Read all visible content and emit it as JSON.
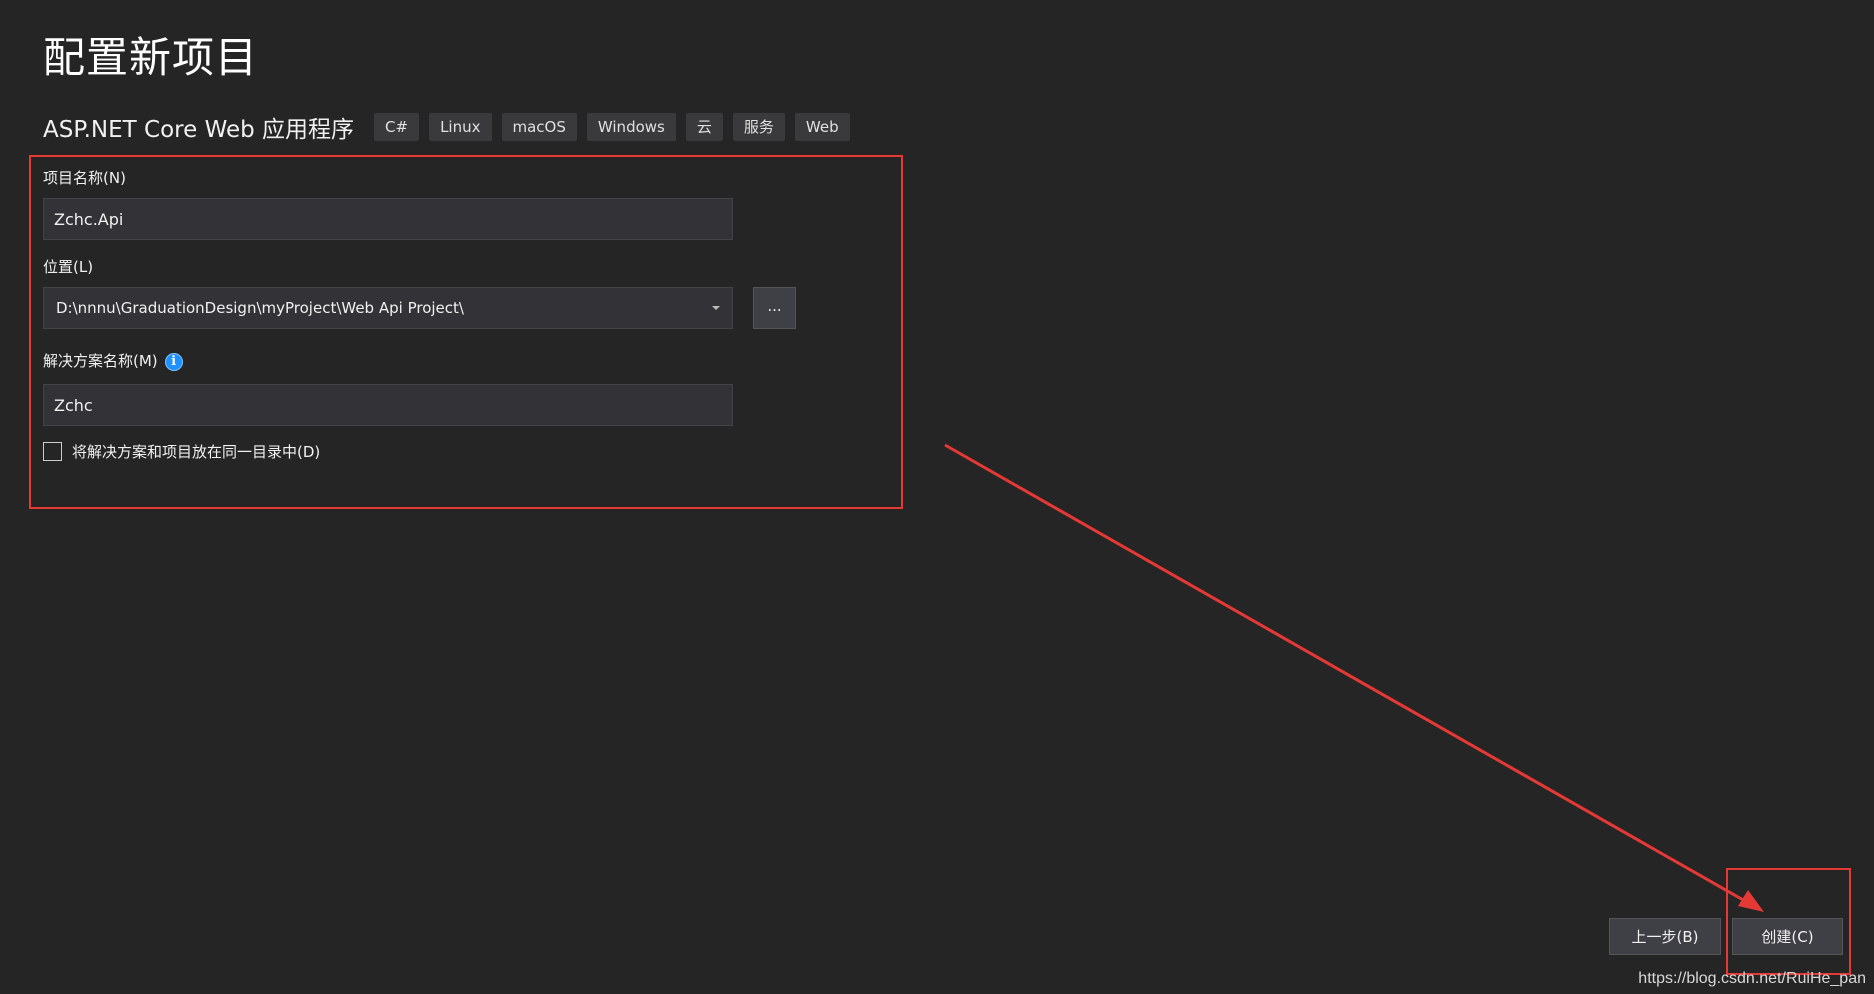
{
  "page": {
    "title": "配置新项目"
  },
  "template": {
    "name": "ASP.NET Core Web 应用程序",
    "tags": [
      "C#",
      "Linux",
      "macOS",
      "Windows",
      "云",
      "服务",
      "Web"
    ]
  },
  "form": {
    "project_name_label": "项目名称(N)",
    "project_name_value": "Zchc.Api",
    "location_label": "位置(L)",
    "location_value": "D:\\nnnu\\GraduationDesign\\myProject\\Web Api Project\\",
    "browse_label": "...",
    "solution_name_label": "解决方案名称(M)",
    "solution_name_value": "Zchc",
    "info_icon_glyph": "i",
    "same_directory_label": "将解决方案和项目放在同一目录中(D)",
    "same_directory_checked": false
  },
  "footer": {
    "back_label": "上一步(B)",
    "create_label": "创建(C)"
  },
  "watermark": {
    "text": "https://blog.csdn.net/RuiHe_pan"
  },
  "icons": {
    "location_dropdown": "chevron-down-icon",
    "solution_info": "info-icon"
  },
  "colors": {
    "background": "#252526",
    "input_background": "#333337",
    "tag_background": "#3a3a3c",
    "annotation_red": "#e53935",
    "info_blue": "#1e90ff"
  }
}
